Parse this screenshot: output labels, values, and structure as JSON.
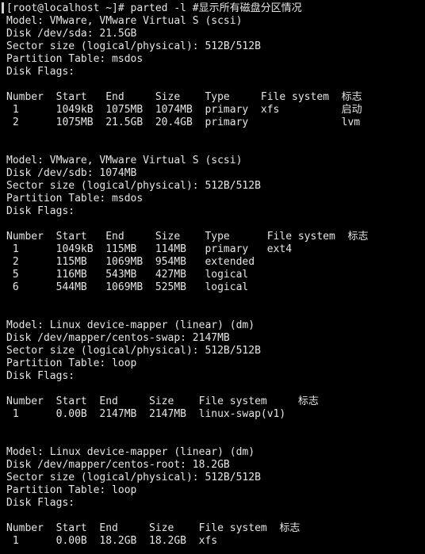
{
  "terminal": {
    "lines": [
      "[root@localhost ~]# parted -l #显示所有磁盘分区情况",
      "Model: VMware, VMware Virtual S (scsi)",
      "Disk /dev/sda: 21.5GB",
      "Sector size (logical/physical): 512B/512B",
      "Partition Table: msdos",
      "Disk Flags:",
      "",
      "Number  Start   End     Size    Type     File system  标志",
      " 1      1049kB  1075MB  1074MB  primary  xfs          启动",
      " 2      1075MB  21.5GB  20.4GB  primary               lvm",
      "",
      "",
      "Model: VMware, VMware Virtual S (scsi)",
      "Disk /dev/sdb: 1074MB",
      "Sector size (logical/physical): 512B/512B",
      "Partition Table: msdos",
      "Disk Flags:",
      "",
      "Number  Start   End     Size    Type      File system  标志",
      " 1      1049kB  115MB   114MB   primary   ext4",
      " 2      115MB   1069MB  954MB   extended",
      " 5      116MB   543MB   427MB   logical",
      " 6      544MB   1069MB  525MB   logical",
      "",
      "",
      "Model: Linux device-mapper (linear) (dm)",
      "Disk /dev/mapper/centos-swap: 2147MB",
      "Sector size (logical/physical): 512B/512B",
      "Partition Table: loop",
      "Disk Flags:",
      "",
      "Number  Start  End     Size    File system     标志",
      " 1      0.00B  2147MB  2147MB  linux-swap(v1)",
      "",
      "",
      "Model: Linux device-mapper (linear) (dm)",
      "Disk /dev/mapper/centos-root: 18.2GB",
      "Sector size (logical/physical): 512B/512B",
      "Partition Table: loop",
      "Disk Flags:",
      "",
      "Number  Start  End     Size    File system  标志",
      " 1      0.00B  18.2GB  18.2GB  xfs"
    ]
  }
}
